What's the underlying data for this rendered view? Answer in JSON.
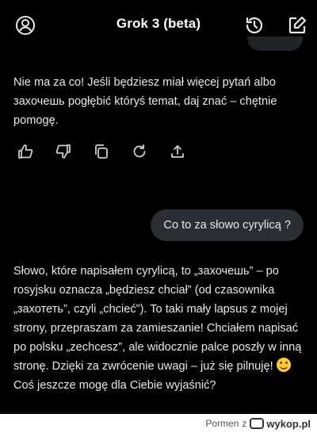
{
  "header": {
    "title": "Grok 3 (beta)",
    "icons": [
      "profile-icon",
      "history-icon",
      "compose-icon"
    ]
  },
  "messages": {
    "assistant_1": "Nie ma za co! Jeśli będziesz miał więcej pytań albo захочешь pogłębić któryś temat, daj znać – chętnie pomogę.",
    "user_1": "Co to za słowo cyrylicą ?",
    "assistant_2_part1": "Słowo, które napisałem cyrylicą, to „захочешь” – po rosyjsku oznacza „będziesz chciał” (od czasownika „захотеть”, czyli „chcieć”). To taki mały lapsus z mojej strony, przepraszam za zamieszanie! Chciałem napisać po polsku „zechcesz”, ale widocznie palce poszły w inną stronę. Dzięki za zwrócenie uwagi – już się pilnuję! ",
    "assistant_2_part2": " Coś jeszcze mogę dla Ciebie wyjaśnić?"
  },
  "actions": [
    "thumbs-up-icon",
    "thumbs-down-icon",
    "copy-icon",
    "regenerate-icon",
    "share-icon"
  ],
  "footer": {
    "user": "Pormen",
    "sep": "z",
    "site": "wykop.pl"
  }
}
